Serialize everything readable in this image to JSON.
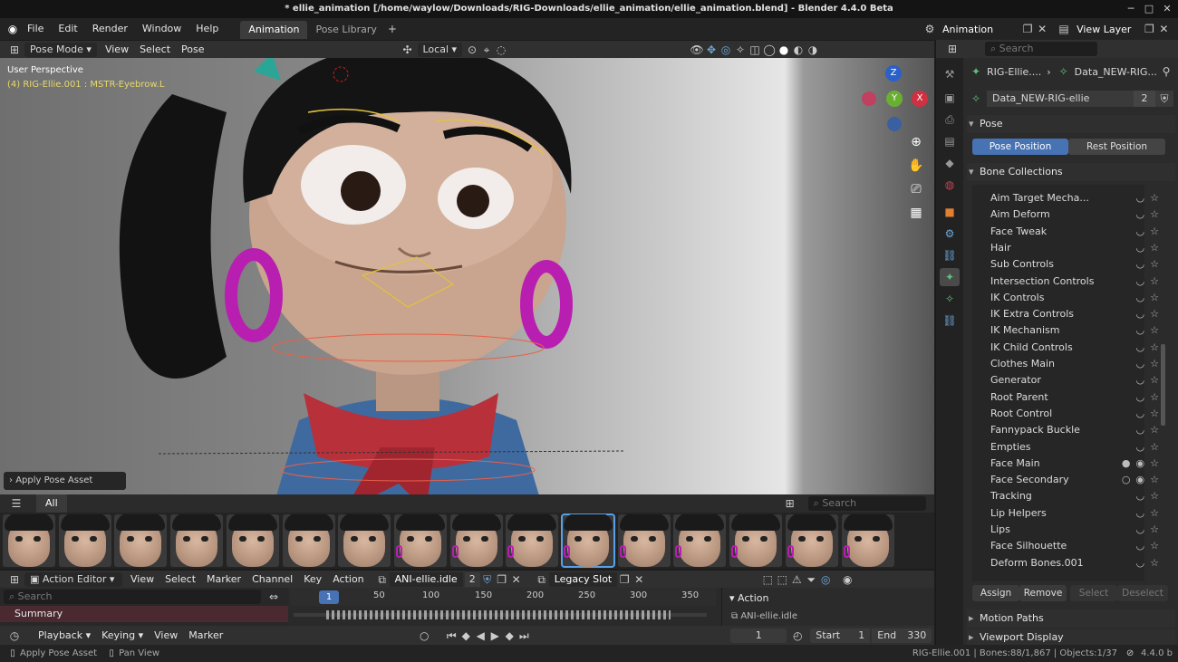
{
  "title_bar": {
    "title": "* ellie_animation [/home/waylow/Downloads/RIG-Downloads/ellie_animation/ellie_animation.blend] - Blender 4.4.0 Beta",
    "minimize_icon": "─",
    "maximize_icon": "□",
    "close_icon": "✕"
  },
  "menu": {
    "items": [
      "File",
      "Edit",
      "Render",
      "Window",
      "Help"
    ],
    "workspace_tabs": [
      "Animation",
      "Pose Library"
    ],
    "add_tab": "+",
    "scene": "Animation",
    "view_layer": "View Layer"
  },
  "viewport_header": {
    "mode": "Pose Mode",
    "menus": [
      "View",
      "Select",
      "Pose"
    ],
    "orientation": "Local"
  },
  "viewport": {
    "info_line1": "User Perspective",
    "info_line2": "(4) RIG-Ellie.001 : MSTR-Eyebrow.L",
    "last_op": "Apply Pose Asset",
    "gizmo": {
      "z": "Z",
      "y": "Y",
      "x": "X"
    }
  },
  "asset_browser": {
    "catalog": "All",
    "search_placeholder": "Search",
    "thumbnail_count": 16,
    "selected_index": 10
  },
  "action_editor": {
    "editor": "Action Editor",
    "menus": [
      "View",
      "Select",
      "Marker",
      "Channel",
      "Key",
      "Action"
    ],
    "action_name": "ANI-ellie.idle",
    "users": "2",
    "slot": "Legacy Slot",
    "search_placeholder": "Search",
    "summary": "Summary",
    "current_frame": "1",
    "ruler_ticks": [
      "50",
      "100",
      "150",
      "200",
      "250",
      "300",
      "350"
    ],
    "panel_title": "Action",
    "panel_action": "ANI-ellie.idle"
  },
  "playback": {
    "menus": [
      "Playback",
      "Keying",
      "View",
      "Marker"
    ],
    "frame": "1",
    "start_label": "Start",
    "start": "1",
    "end_label": "End",
    "end": "330"
  },
  "status": {
    "left1": "Apply Pose Asset",
    "left2": "Pan View",
    "right": "RIG-Ellie.001 | Bones:88/1,867 | Objects:1/37",
    "version": "4.4.0 b"
  },
  "properties": {
    "search_placeholder": "Search",
    "breadcrumb1": "RIG-Ellie....",
    "breadcrumb2": "Data_NEW-RIG...",
    "datablock": "Data_NEW-RIG-ellie",
    "users": "2",
    "pose_panel": "Pose",
    "pose_position": "Pose Position",
    "rest_position": "Rest Position",
    "bone_collections_panel": "Bone Collections",
    "bone_collections": [
      "Aim Target Mecha...",
      "Aim Deform",
      "Face Tweak",
      "Hair",
      "Sub Controls",
      "Intersection Controls",
      "IK Controls",
      "IK Extra Controls",
      "IK Mechanism",
      "IK Child Controls",
      "Clothes Main",
      "Generator",
      "Root Parent",
      "Root Control",
      "Fannypack Buckle",
      "Empties",
      "Face Main",
      "Face Secondary",
      "Tracking",
      "Lip Helpers",
      "Lips",
      "Face Silhouette",
      "Deform Bones.001"
    ],
    "visible_collections": [
      "Face Main",
      "Face Secondary"
    ],
    "assign": "Assign",
    "remove": "Remove",
    "select": "Select",
    "deselect": "Deselect",
    "motion_paths": "Motion Paths",
    "viewport_display": "Viewport Display"
  },
  "colors": {
    "accent": "#4772b3",
    "summary_bg": "#4a2a30",
    "active_bone_text": "#e6d96a"
  }
}
